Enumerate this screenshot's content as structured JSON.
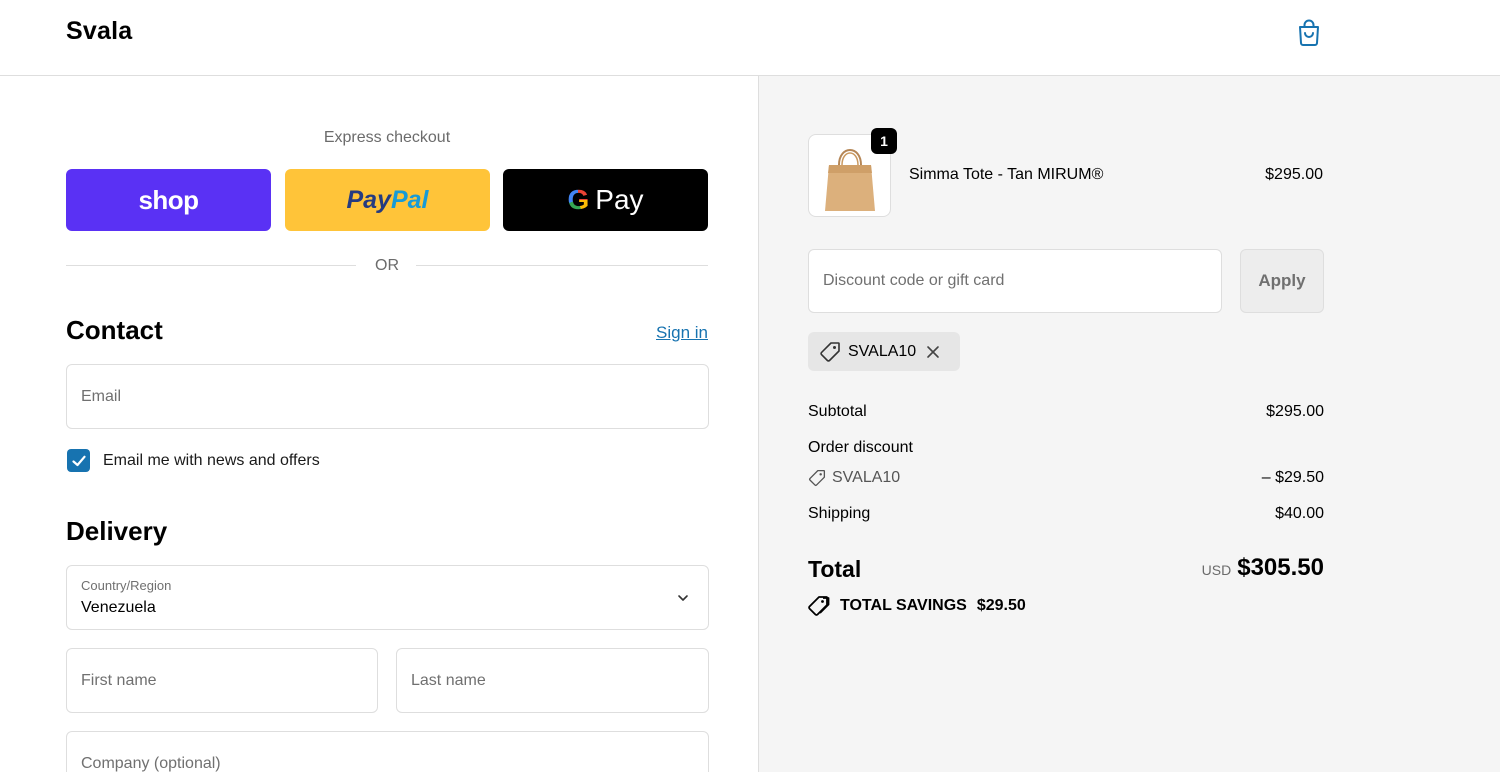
{
  "header": {
    "brand": "Svala"
  },
  "express": {
    "label": "Express checkout",
    "shop_label": "shop",
    "paypal_part1": "Pay",
    "paypal_part2": "Pal",
    "gpay_g": "G",
    "gpay_label": "Pay",
    "or": "OR"
  },
  "contact": {
    "title": "Contact",
    "sign_in": "Sign in",
    "email_placeholder": "Email",
    "newsletter_label": "Email me with news and offers",
    "newsletter_checked": true
  },
  "delivery": {
    "title": "Delivery",
    "country_label": "Country/Region",
    "country_value": "Venezuela",
    "first_name_placeholder": "First name",
    "last_name_placeholder": "Last name",
    "company_placeholder": "Company (optional)"
  },
  "order": {
    "item": {
      "name": "Simma Tote - Tan MIRUM®",
      "price": "$295.00",
      "quantity": "1"
    },
    "discount_placeholder": "Discount code or gift card",
    "apply_label": "Apply",
    "applied_code": "SVALA10",
    "subtotal_label": "Subtotal",
    "subtotal_value": "$295.00",
    "order_discount_label": "Order discount",
    "discount_code": "SVALA10",
    "discount_value": "– $29.50",
    "shipping_label": "Shipping",
    "shipping_value": "$40.00",
    "total_label": "Total",
    "total_currency": "USD",
    "total_value": "$305.50",
    "savings_label": "TOTAL SAVINGS",
    "savings_value": "$29.50"
  },
  "colors": {
    "shop": "#5a31f4",
    "paypal": "#ffc439",
    "gpay": "#000000",
    "link": "#1773b0",
    "summary_bg": "#f5f5f5"
  }
}
